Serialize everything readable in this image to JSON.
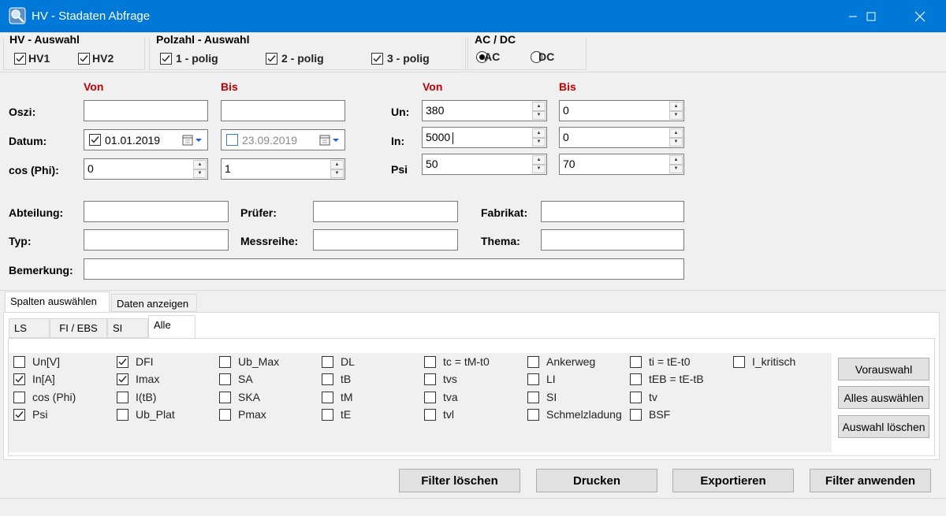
{
  "window": {
    "title": "HV - Stadaten  Abfrage",
    "icon": "app-icon"
  },
  "hv_group": {
    "title": "HV - Auswahl",
    "items": [
      {
        "label": "HV1",
        "checked": true
      },
      {
        "label": "HV2",
        "checked": true
      }
    ]
  },
  "pol_group": {
    "title": "Polzahl - Auswahl",
    "items": [
      {
        "label": "1 - polig",
        "checked": true
      },
      {
        "label": "2 - polig",
        "checked": true
      },
      {
        "label": "3 - polig",
        "checked": true
      }
    ]
  },
  "acdc_group": {
    "title": "AC / DC",
    "items": [
      {
        "label": "AC",
        "selected": true
      },
      {
        "label": "DC",
        "selected": false
      }
    ]
  },
  "headers": {
    "von": "Von",
    "bis": "Bis"
  },
  "left_rows": {
    "oszi": {
      "label": "Oszi:",
      "von": "",
      "bis": ""
    },
    "datum": {
      "label": "Datum:",
      "von": "01.01.2019",
      "bis": "23.09.2019"
    },
    "cosphi": {
      "label": "cos (Phi):",
      "von": "0",
      "bis": "1"
    }
  },
  "right_rows": {
    "un": {
      "label": "Un:",
      "von": "380",
      "bis": "0"
    },
    "in": {
      "label": "In:",
      "von": "5000",
      "bis": "0"
    },
    "psi": {
      "label": "Psi",
      "von": "50",
      "bis": "70"
    }
  },
  "text_fields": {
    "abteilung": {
      "label": "Abteilung:",
      "value": ""
    },
    "pruefer": {
      "label": "Prüfer:",
      "value": ""
    },
    "fabrikat": {
      "label": "Fabrikat:",
      "value": ""
    },
    "typ": {
      "label": "Typ:",
      "value": ""
    },
    "messreihe": {
      "label": "Messreihe:",
      "value": ""
    },
    "thema": {
      "label": "Thema:",
      "value": ""
    },
    "bemerkung": {
      "label": "Bemerkung:",
      "value": ""
    }
  },
  "outer_tabs": [
    "Spalten auswählen",
    "Daten anzeigen"
  ],
  "inner_tabs": [
    "LS",
    "FI / EBS",
    "SI",
    "Alle"
  ],
  "columns": [
    [
      {
        "label": "Un[V]",
        "checked": false
      },
      {
        "label": "In[A]",
        "checked": true
      },
      {
        "label": "cos (Phi)",
        "checked": false
      },
      {
        "label": "Psi",
        "checked": true
      }
    ],
    [
      {
        "label": "DFI",
        "checked": true
      },
      {
        "label": "Imax",
        "checked": true
      },
      {
        "label": "I(tB)",
        "checked": false
      },
      {
        "label": "Ub_Plat",
        "checked": false
      }
    ],
    [
      {
        "label": "Ub_Max",
        "checked": false
      },
      {
        "label": "SA",
        "checked": false
      },
      {
        "label": "SKA",
        "checked": false
      },
      {
        "label": "Pmax",
        "checked": false
      }
    ],
    [
      {
        "label": "DL",
        "checked": false
      },
      {
        "label": "tB",
        "checked": false
      },
      {
        "label": "tM",
        "checked": false
      },
      {
        "label": "tE",
        "checked": false
      }
    ],
    [
      {
        "label": "tc = tM-t0",
        "checked": false
      },
      {
        "label": "tvs",
        "checked": false
      },
      {
        "label": "tva",
        "checked": false
      },
      {
        "label": "tvl",
        "checked": false
      }
    ],
    [
      {
        "label": "Ankerweg",
        "checked": false
      },
      {
        "label": "LI",
        "checked": false
      },
      {
        "label": "SI",
        "checked": false
      },
      {
        "label": "Schmelzladung",
        "checked": false
      }
    ],
    [
      {
        "label": "ti = tE-t0",
        "checked": false
      },
      {
        "label": "tEB = tE-tB",
        "checked": false
      },
      {
        "label": "tv",
        "checked": false
      },
      {
        "label": "BSF",
        "checked": false
      }
    ],
    [
      {
        "label": "I_kritisch",
        "checked": false
      }
    ]
  ],
  "side_buttons": [
    "Vorauswahl",
    "Alles auswählen",
    "Auswahl löschen"
  ],
  "bottom_buttons": [
    "Filter löschen",
    "Drucken",
    "Exportieren",
    "Filter anwenden"
  ]
}
